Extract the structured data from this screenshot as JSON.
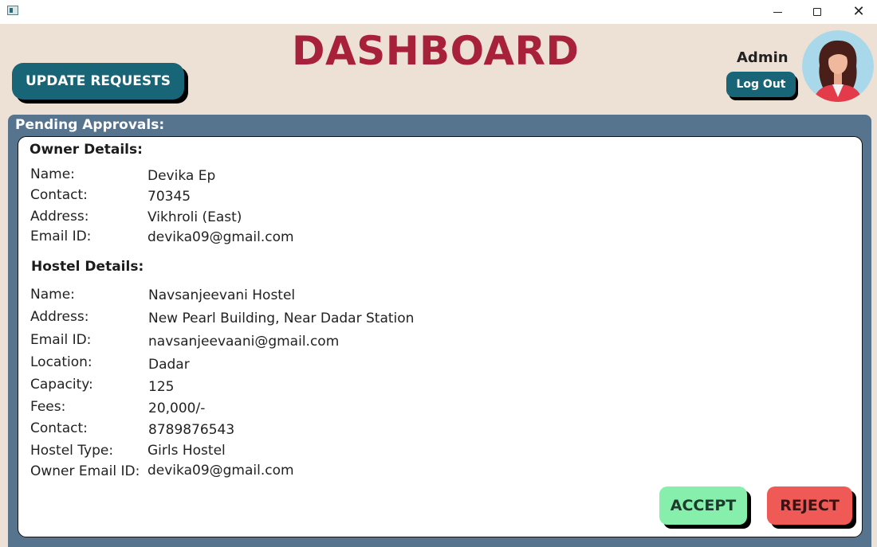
{
  "window": {
    "min_icon": "minimize-icon",
    "max_icon": "maximize-icon",
    "close_icon": "close-icon",
    "close_glyph": "✕"
  },
  "header": {
    "title": "DASHBOARD",
    "update_requests_label": "UPDATE REQUESTS",
    "admin_label": "Admin",
    "logout_label": "Log Out"
  },
  "panel": {
    "title": "Pending Approvals:",
    "owner": {
      "heading": "Owner Details:",
      "rows": [
        {
          "label": "Name:",
          "value": "Devika Ep"
        },
        {
          "label": "Contact:",
          "value": "70345"
        },
        {
          "label": "Address:",
          "value": "Vikhroli (East)"
        },
        {
          "label": "Email ID:",
          "value": "devika09@gmail.com"
        }
      ]
    },
    "hostel": {
      "heading": "Hostel Details:",
      "rows": [
        {
          "label": "Name:",
          "value": "Navsanjeevani Hostel"
        },
        {
          "label": "Address:",
          "value": "New Pearl Building, Near Dadar Station"
        },
        {
          "label": "Email ID:",
          "value": "navsanjeevaani@gmail.com"
        },
        {
          "label": "Location:",
          "value": "Dadar"
        },
        {
          "label": "Capacity:",
          "value": "125"
        },
        {
          "label": "Fees:",
          "value": "20,000/-"
        },
        {
          "label": "Contact:",
          "value": "8789876543"
        },
        {
          "label": "Hostel Type:",
          "value": "Girls Hostel"
        },
        {
          "label": "Owner Email ID:",
          "value": "devika09@gmail.com"
        }
      ]
    },
    "accept_label": "ACCEPT",
    "reject_label": "REJECT"
  },
  "colors": {
    "accent": "#196578",
    "title": "#a8213b",
    "panel": "#57748f",
    "accept": "#86efac",
    "reject": "#ef5a57",
    "background": "#ede1d6"
  }
}
